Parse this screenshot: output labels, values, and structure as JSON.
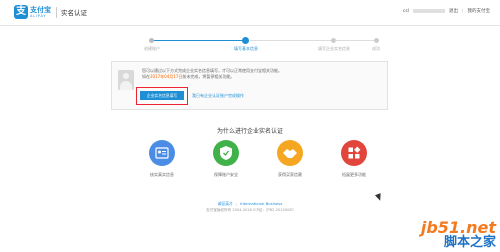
{
  "header": {
    "logo_mark": "支",
    "logo_text": "支付宝",
    "logo_sub": "ALIPAY",
    "section_title": "实名认证",
    "user_prefix": "csl",
    "logout": "退出",
    "my_alipay": "我的支付宝"
  },
  "steps": [
    {
      "label": "创建账户",
      "state": "done"
    },
    {
      "label": "填写基本信息",
      "state": "active"
    },
    {
      "label": "填写企业实名信息",
      "state": "todo"
    },
    {
      "label": "成功",
      "state": "todo"
    }
  ],
  "info": {
    "line1": "您可以通过以下方式完成企业实名信息填写，才可以正常使用支付宝相关功能。",
    "line2_prefix": "如在",
    "line2_highlight": "2017年04月17日",
    "line2_suffix": "前未完成，将暂停相关功能。",
    "fill_button": "企业实名信息填写",
    "alt_link": "我已有企业认证账户完成操作"
  },
  "why": {
    "title": "为什么进行企业实名认证",
    "features": [
      {
        "label": "核实真实信息",
        "icon": "id-card-icon",
        "color": "#4b8de4"
      },
      {
        "label": "保障账户安全",
        "icon": "shield-icon",
        "color": "#41b14a"
      },
      {
        "label": "获得买家信赖",
        "icon": "handshake-icon",
        "color": "#f5a722"
      },
      {
        "label": "拓展更多功能",
        "icon": "apps-grid-icon",
        "color": "#e2453c"
      }
    ]
  },
  "footer": {
    "links": [
      "诚征英才",
      "International Business"
    ],
    "copyright": "支付宝版权所有 2004-2016 ICP证：沪B2-20150087"
  },
  "watermark": {
    "line1": "jb51.net",
    "line2": "脚本之家"
  }
}
